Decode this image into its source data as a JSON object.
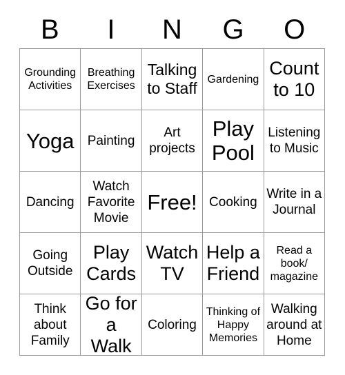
{
  "card": {
    "title_letters": [
      "B",
      "I",
      "N",
      "G",
      "O"
    ],
    "columns": 5,
    "rows": 5,
    "free_space_label": "Free!",
    "colors": {
      "border": "#9a9a9a",
      "text": "#000000",
      "background": "#ffffff"
    },
    "cells": [
      [
        {
          "label": "Grounding Activities",
          "size": "fs-sm"
        },
        {
          "label": "Breathing Exercises",
          "size": "fs-sm"
        },
        {
          "label": "Talking to Staff",
          "size": "fs-lg"
        },
        {
          "label": "Gardening",
          "size": "fs-sm"
        },
        {
          "label": "Count to 10",
          "size": "fs-xl"
        }
      ],
      [
        {
          "label": "Yoga",
          "size": "fs-xxl"
        },
        {
          "label": "Painting",
          "size": "fs-md"
        },
        {
          "label": "Art projects",
          "size": "fs-md"
        },
        {
          "label": "Play Pool",
          "size": "fs-xxl"
        },
        {
          "label": "Listening to Music",
          "size": "fs-md"
        }
      ],
      [
        {
          "label": "Dancing",
          "size": "fs-md"
        },
        {
          "label": "Watch Favorite Movie",
          "size": "fs-md"
        },
        {
          "label": "Free!",
          "size": "fs-xxl"
        },
        {
          "label": "Cooking",
          "size": "fs-md"
        },
        {
          "label": "Write in a Journal",
          "size": "fs-md"
        }
      ],
      [
        {
          "label": "Going Outside",
          "size": "fs-md"
        },
        {
          "label": "Play Cards",
          "size": "fs-xl"
        },
        {
          "label": "Watch TV",
          "size": "fs-xl"
        },
        {
          "label": "Help a Friend",
          "size": "fs-xl"
        },
        {
          "label": "Read a book/ magazine",
          "size": "fs-sm"
        }
      ],
      [
        {
          "label": "Think about Family",
          "size": "fs-md"
        },
        {
          "label": "Go for a Walk",
          "size": "fs-xl"
        },
        {
          "label": "Coloring",
          "size": "fs-md"
        },
        {
          "label": "Thinking of Happy Memories",
          "size": "fs-sm"
        },
        {
          "label": "Walking around at Home",
          "size": "fs-md"
        }
      ]
    ]
  }
}
